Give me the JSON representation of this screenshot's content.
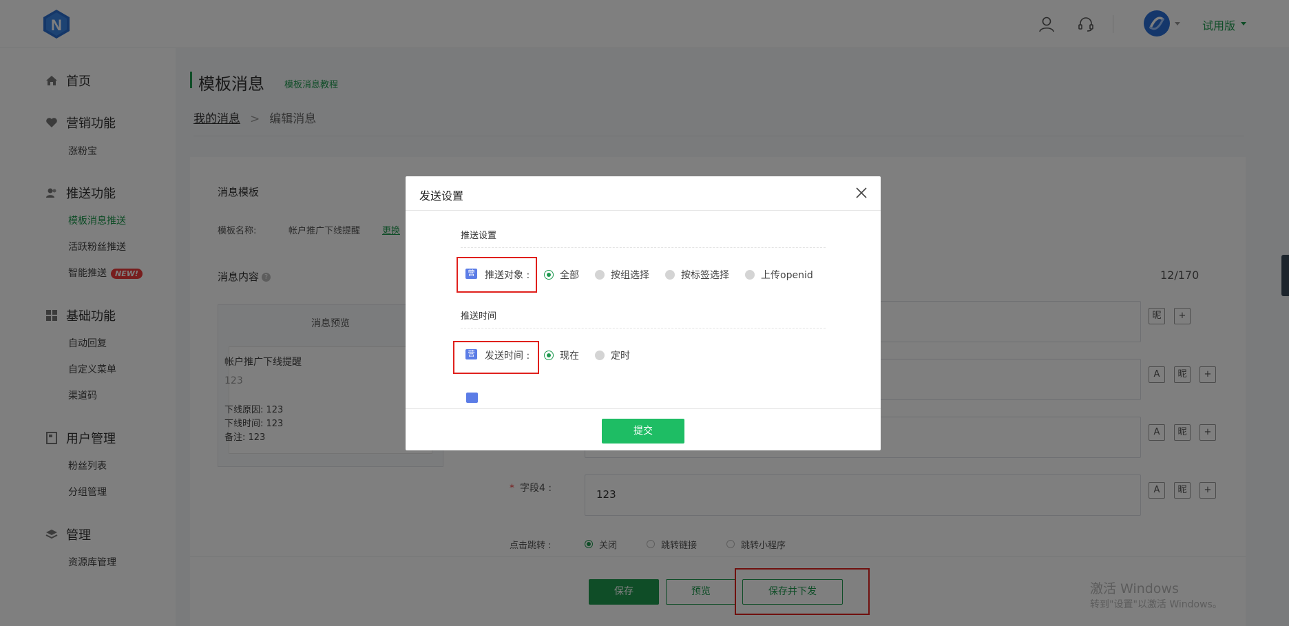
{
  "header": {
    "trial_label": "试用版"
  },
  "sidebar": {
    "groups": [
      {
        "label": "首页",
        "icon": "home-icon",
        "items": []
      },
      {
        "label": "营销功能",
        "icon": "heart-icon",
        "items": [
          "涨粉宝"
        ]
      },
      {
        "label": "推送功能",
        "icon": "user-icon",
        "items": [
          "模板消息推送",
          "活跃粉丝推送",
          "智能推送"
        ]
      },
      {
        "label": "基础功能",
        "icon": "grid-icon",
        "items": [
          "自动回复",
          "自定义菜单",
          "渠道码"
        ]
      },
      {
        "label": "用户管理",
        "icon": "doc-icon",
        "items": [
          "粉丝列表",
          "分组管理"
        ]
      },
      {
        "label": "管理",
        "icon": "layers-icon",
        "items": [
          "资源库管理"
        ]
      }
    ],
    "active_item": "模板消息推送",
    "new_badge": "NEW!"
  },
  "page": {
    "title": "模板消息",
    "tutorial_link": "模板消息教程",
    "breadcrumb": {
      "parent": "我的消息",
      "separator": ">",
      "current": "编辑消息"
    }
  },
  "form": {
    "template_section": "消息模板",
    "template_name_label": "模板名称:",
    "template_name_value": "帐户推广下线提醒",
    "change_link": "更换",
    "content_section": "消息内容",
    "counter": "12/170",
    "preview": {
      "header": "消息预览",
      "title": "帐户推广下线提醒",
      "first": "123",
      "lines": [
        "下线原因: 123",
        "下线时间: 123",
        "备注: 123"
      ]
    },
    "field4_label": "字段4 :",
    "field4_value": "123",
    "tool_labels": {
      "text": "A",
      "nick": "昵",
      "add": "+"
    },
    "jump_label": "点击跳转 :",
    "jump_options": [
      "关闭",
      "跳转链接",
      "跳转小程序"
    ],
    "jump_selected": "关闭"
  },
  "footer": {
    "save": "保存",
    "preview": "预览",
    "save_and_send": "保存并下发"
  },
  "watermark": {
    "line1": "激活 Windows",
    "line2": "转到\"设置\"以激活 Windows。"
  },
  "modal": {
    "title": "发送设置",
    "push_settings_section": "推送设置",
    "target_tag": "营",
    "target_label": "推送对象 :",
    "target_options": [
      "全部",
      "按组选择",
      "按标签选择",
      "上传openid"
    ],
    "target_selected": "全部",
    "time_section": "推送时间",
    "time_tag": "营",
    "time_label": "发送时间 :",
    "time_options": [
      "现在",
      "定时"
    ],
    "time_selected": "现在",
    "submit": "提交"
  },
  "colors": {
    "brand_green": "#1e9a4f",
    "submit_green": "#1ebd64",
    "highlight_red": "#e0201c",
    "tag_blue": "#5b7ce6",
    "badge_red": "#ee3b3b"
  }
}
